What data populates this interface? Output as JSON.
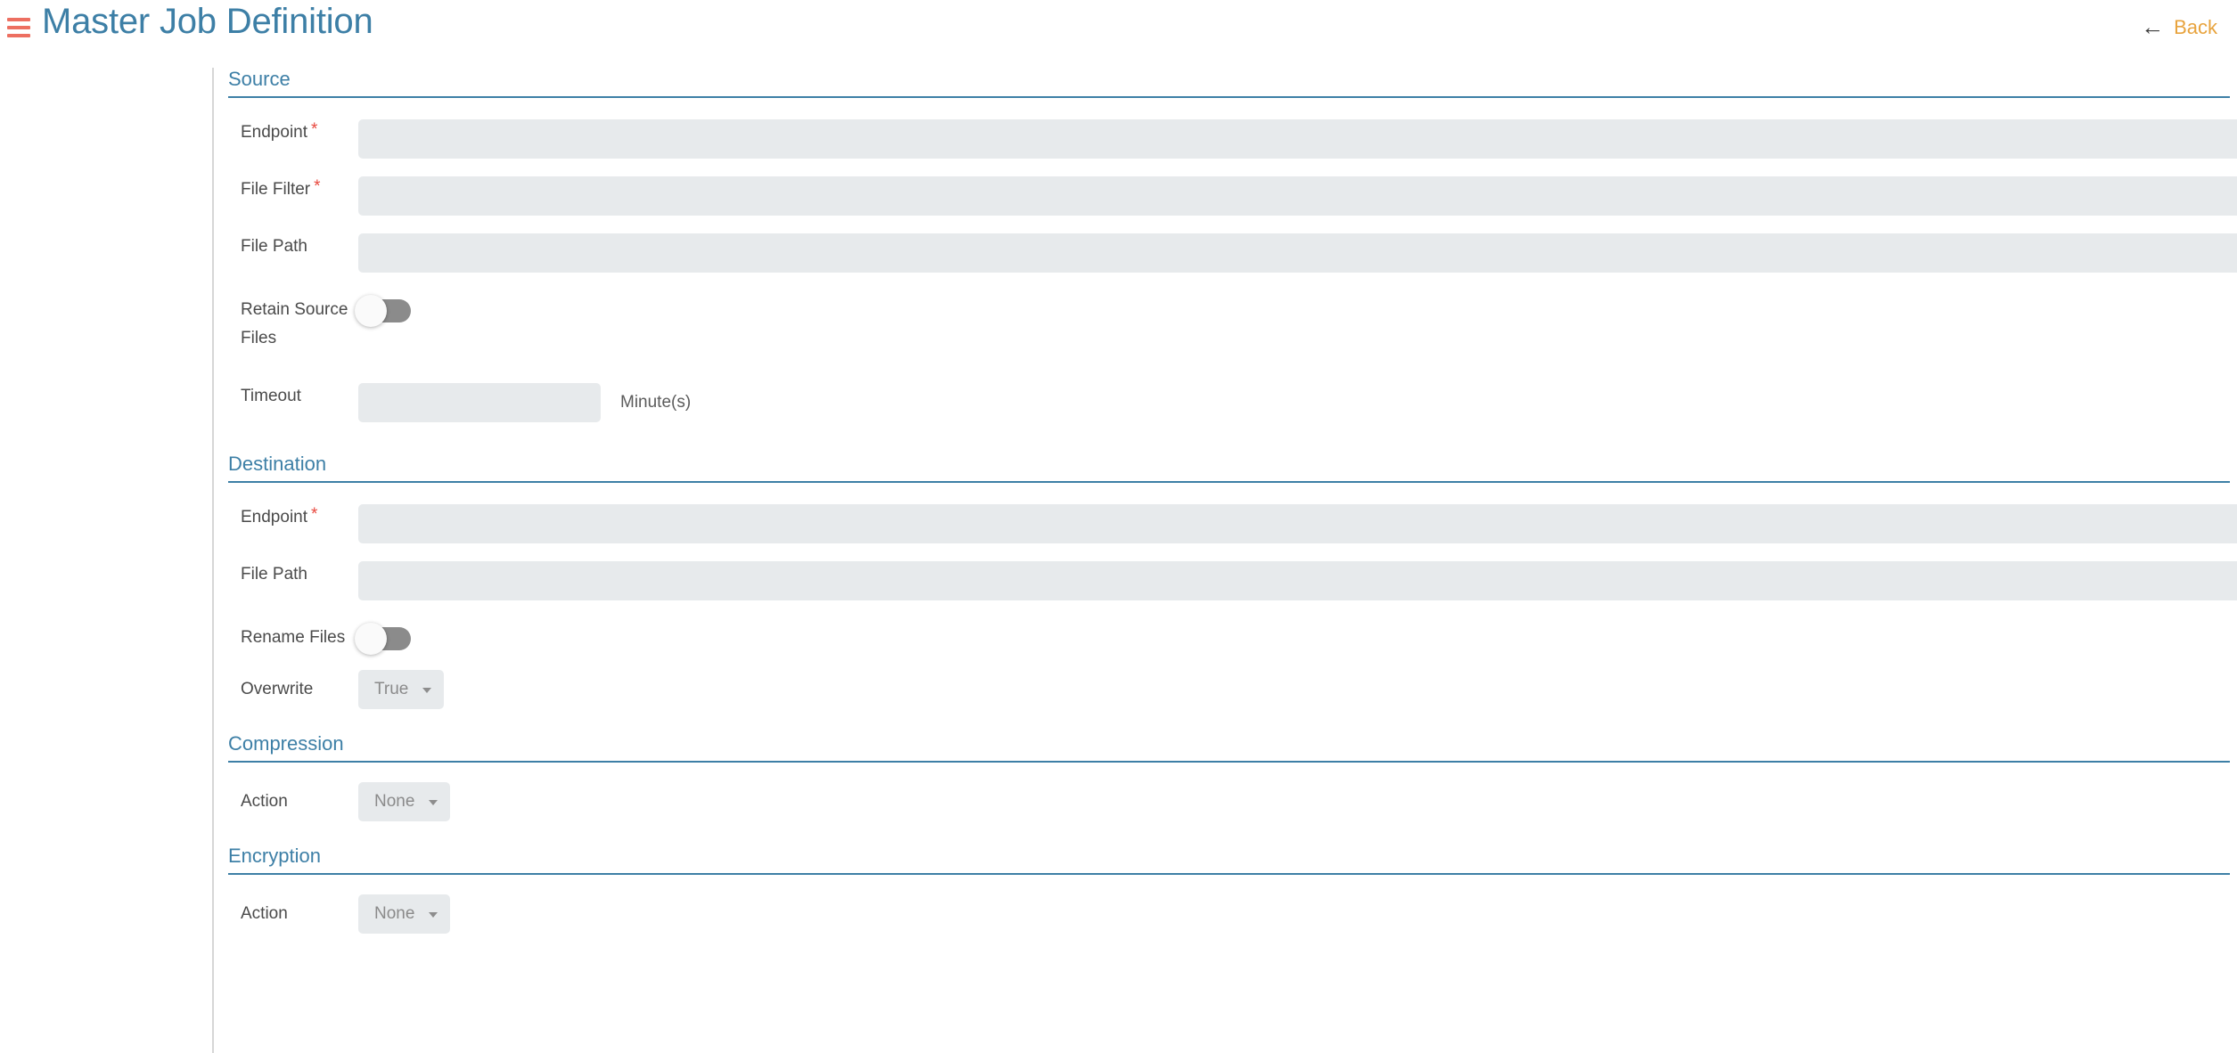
{
  "header": {
    "menu_icon": "hamburger-icon",
    "title": "Master Job Definition",
    "back": {
      "icon": "arrow-left-icon",
      "label": "Back"
    }
  },
  "form": {
    "required_marker": "*",
    "sections": [
      {
        "id": "source",
        "title": "Source",
        "fields": [
          {
            "id": "source-endpoint",
            "label": "Endpoint",
            "required": true,
            "type": "select",
            "value": "",
            "placeholder": ""
          },
          {
            "id": "source-file-filter",
            "label": "File Filter",
            "required": true,
            "type": "text",
            "value": "",
            "placeholder": ""
          },
          {
            "id": "source-file-path",
            "label": "File Path",
            "required": false,
            "type": "text",
            "value": "",
            "placeholder": ""
          },
          {
            "id": "retain-source-files",
            "label": "Retain Source Files",
            "required": false,
            "type": "toggle",
            "value": "off"
          },
          {
            "id": "source-timeout",
            "label": "Timeout",
            "required": false,
            "type": "text-small",
            "value": "",
            "placeholder": "",
            "suffix": "Minute(s)"
          }
        ]
      },
      {
        "id": "destination",
        "title": "Destination",
        "fields": [
          {
            "id": "destination-endpoint",
            "label": "Endpoint",
            "required": true,
            "type": "select",
            "value": "",
            "placeholder": ""
          },
          {
            "id": "destination-file-path",
            "label": "File Path",
            "required": false,
            "type": "text",
            "value": "",
            "placeholder": ""
          },
          {
            "id": "rename-files",
            "label": "Rename Files",
            "required": false,
            "type": "toggle",
            "value": "off"
          },
          {
            "id": "overwrite",
            "label": "Overwrite",
            "required": false,
            "type": "pill-select",
            "value": "True"
          }
        ]
      },
      {
        "id": "compression",
        "title": "Compression",
        "fields": [
          {
            "id": "compression-action",
            "label": "Action",
            "required": false,
            "type": "pill-select",
            "value": "None"
          }
        ]
      },
      {
        "id": "encryption",
        "title": "Encryption",
        "fields": [
          {
            "id": "encryption-action",
            "label": "Action",
            "required": false,
            "type": "pill-select",
            "value": "None"
          }
        ]
      }
    ]
  },
  "colors": {
    "accent_blue": "#3d7fa6",
    "menu_red": "#ed6f61",
    "required_red": "#e8493f",
    "back_amber": "#e8a33d",
    "field_bg": "#e7eaec",
    "toggle_track": "#8b8b8b"
  }
}
